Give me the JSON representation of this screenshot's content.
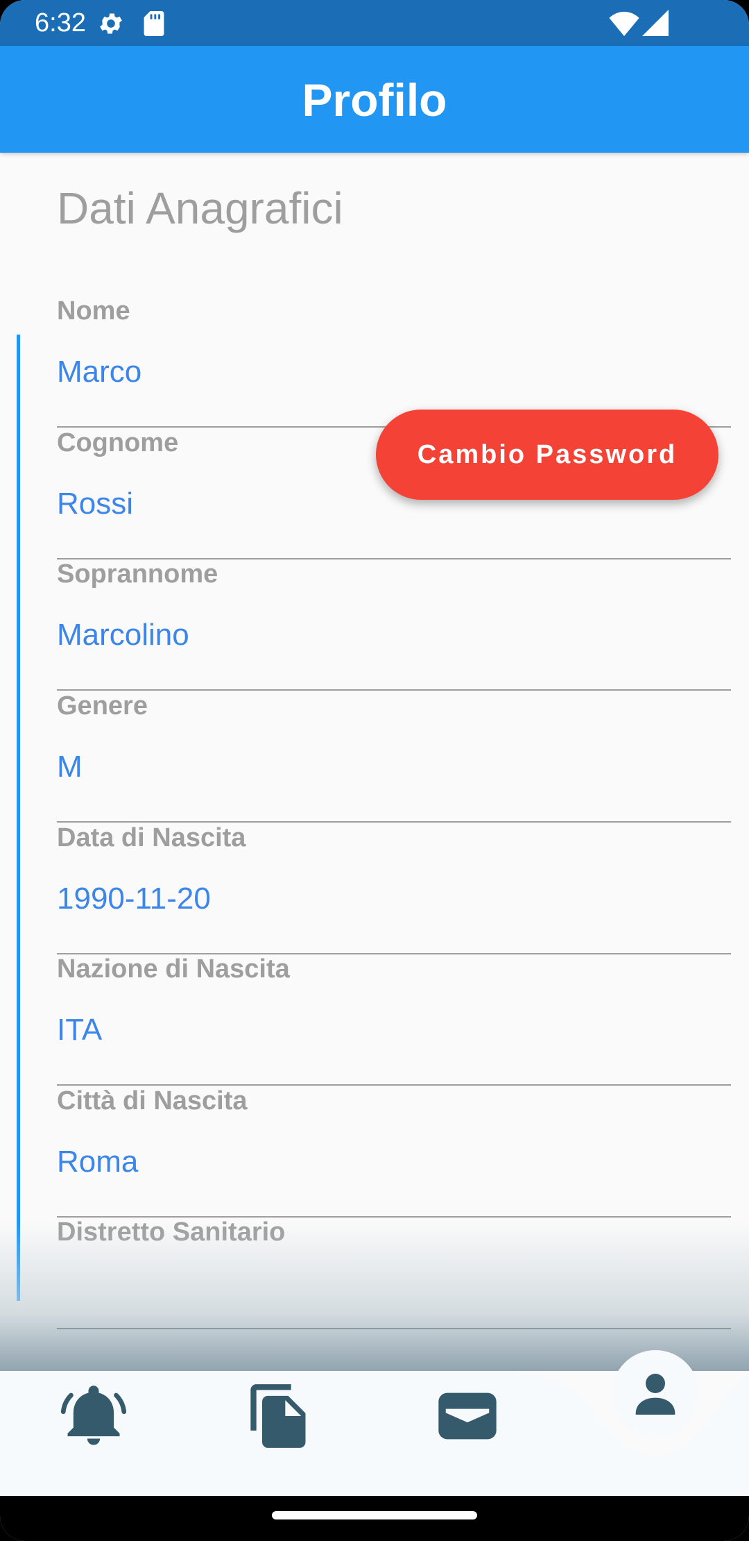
{
  "status_bar": {
    "time": "6:32",
    "icons": [
      "gear-icon",
      "sd-card-icon",
      "wifi-icon",
      "signal-icon"
    ]
  },
  "app_bar": {
    "title": "Profilo"
  },
  "section": {
    "title": "Dati Anagrafici"
  },
  "actions": {
    "change_password": "Cambio Password"
  },
  "fields": [
    {
      "label": "Nome",
      "value": "Marco"
    },
    {
      "label": "Cognome",
      "value": "Rossi"
    },
    {
      "label": "Soprannome",
      "value": "Marcolino"
    },
    {
      "label": "Genere",
      "value": "M"
    },
    {
      "label": "Data di Nascita",
      "value": "1990-11-20"
    },
    {
      "label": "Nazione di Nascita",
      "value": "ITA"
    },
    {
      "label": "Città di Nascita",
      "value": "Roma"
    },
    {
      "label": "Distretto Sanitario",
      "value": ""
    }
  ],
  "bottom_nav": {
    "items": [
      "bell-icon",
      "documents-icon",
      "wallet-icon",
      "person-icon"
    ],
    "active": "person-icon"
  },
  "colors": {
    "app_bar": "#2196f3",
    "status_bar": "#1b6eb6",
    "accent_button": "#f44336",
    "value_text": "#3b86e8",
    "label_text": "#9e9e9e",
    "nav_icon": "#355a6b"
  }
}
